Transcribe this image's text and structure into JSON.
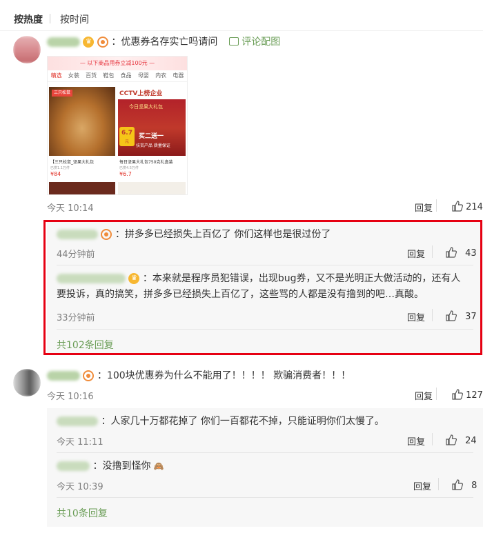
{
  "tabs": {
    "hot": "按热度",
    "time": "按时间"
  },
  "comment1": {
    "text": "：优惠券名存实亡吗请问",
    "img_link": "评论配图",
    "time": "今天 10:14",
    "reply": "回复",
    "likes": "214",
    "image": {
      "banner": "— 以下商品用券立减100元 —",
      "cats": [
        "精选",
        "女装",
        "百货",
        "鞋包",
        "食品",
        "母婴",
        "内衣",
        "电器"
      ],
      "left_badge": "三只松鼠",
      "right_title": "CCTV上榜企业",
      "right_sub1": "今日坚果大礼包",
      "right_sub2": "买二送一",
      "right_sub3": "扶贫产品 质量保证",
      "right_badge": "6.7",
      "right_badge_unit": "元",
      "left_caption": "【三只松鼠_坚果大礼包",
      "left_meta": "已拼1.1万件",
      "left_price": "¥84",
      "right_caption": "每日坚果大礼包750克礼盒装",
      "right_meta": "已拼4.5万件",
      "right_price": "¥6.7"
    },
    "subs": [
      {
        "text": "：拼多多已经损失上百亿了 你们这样也是很过份了",
        "time": "44分钟前",
        "reply": "回复",
        "likes": "43"
      },
      {
        "text1": "：本来就是程序员犯错误，出现bug券，又不是光明正大做活动的，还有人",
        "text2": "要投诉，真的搞笑，拼多多已经损失上百亿了，这些骂的人都是没有撸到的吧…真酸。",
        "time": "33分钟前",
        "reply": "回复",
        "likes": "37"
      }
    ],
    "more": "共102条回复"
  },
  "comment2": {
    "text": "：100块优惠券为什么不能用了！！！！ 欺骗消费者！！！",
    "time": "今天 10:16",
    "reply": "回复",
    "likes": "127",
    "subs": [
      {
        "text": "：人家几十万都花掉了 你们一百都花不掉，只能证明你们太慢了。",
        "time": "今天 11:11",
        "reply": "回复",
        "likes": "24"
      },
      {
        "text": "：没撸到怪你",
        "emoji": "🙈",
        "time": "今天 10:39",
        "reply": "回复",
        "likes": "8"
      }
    ],
    "more": "共10条回复"
  },
  "colors": {
    "accent_green": "#6a9d56",
    "highlight_red": "#e60012",
    "vip_gold": "#f7b731"
  }
}
